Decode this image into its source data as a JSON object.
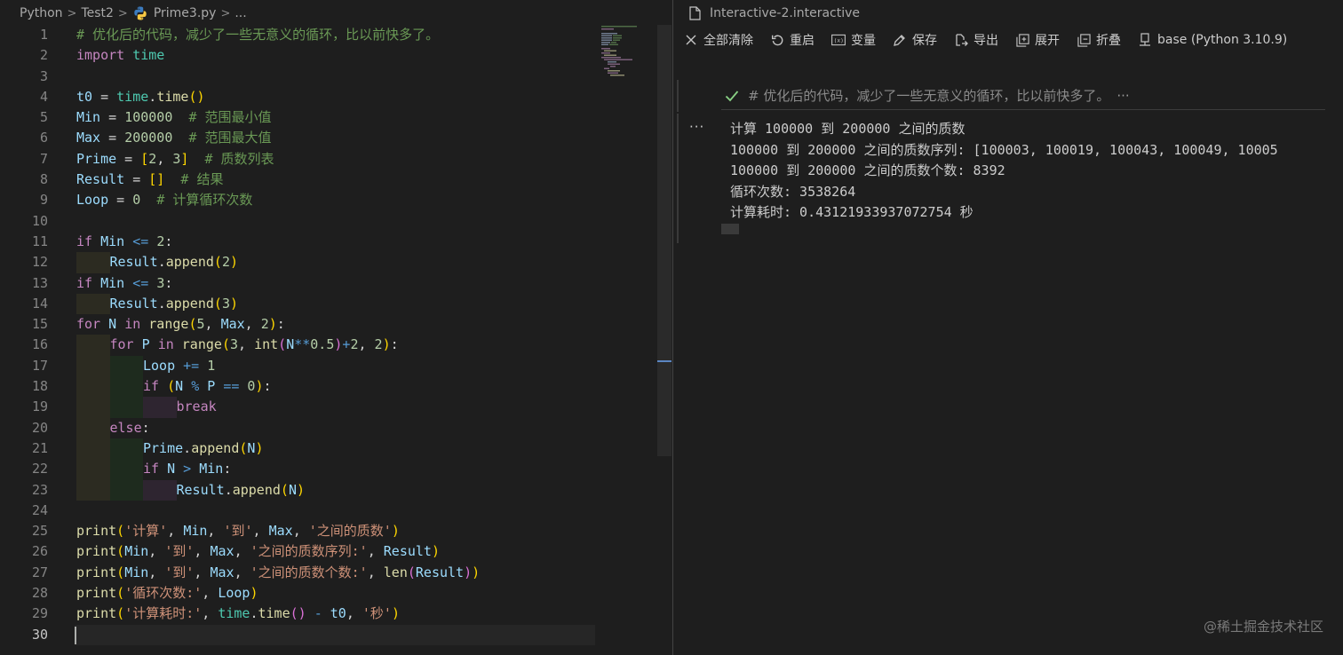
{
  "breadcrumb": {
    "items": [
      "Python",
      "Test2",
      "Prime3.py",
      "..."
    ],
    "separator": ">"
  },
  "editor": {
    "active_line": 30,
    "line_numbers": [
      "1",
      "2",
      "3",
      "4",
      "5",
      "6",
      "7",
      "8",
      "9",
      "10",
      "11",
      "12",
      "13",
      "14",
      "15",
      "16",
      "17",
      "18",
      "19",
      "20",
      "21",
      "22",
      "23",
      "24",
      "25",
      "26",
      "27",
      "28",
      "29",
      "30"
    ],
    "code": {
      "l1": "# 优化后的代码，减少了一些无意义的循环，比以前快多了。",
      "l2_kw": "import",
      "l2_mod": "time",
      "l4_var": "t0",
      "l4_mod": "time",
      "l4_fn": "time",
      "l5_var": "Min",
      "l5_num": "100000",
      "l5_cm": "# 范围最小值",
      "l6_var": "Max",
      "l6_num": "200000",
      "l6_cm": "# 范围最大值",
      "l7_var": "Prime",
      "l7_n1": "2",
      "l7_n2": "3",
      "l7_cm": "# 质数列表",
      "l8_var": "Result",
      "l8_cm": "# 结果",
      "l9_var": "Loop",
      "l9_num": "0",
      "l9_cm": "# 计算循环次数",
      "l11_kw": "if",
      "l11_var": "Min",
      "l11_num": "2",
      "l12_var": "Result",
      "l12_fn": "append",
      "l12_num": "2",
      "l13_kw": "if",
      "l13_var": "Min",
      "l13_num": "3",
      "l14_var": "Result",
      "l14_fn": "append",
      "l14_num": "3",
      "l15_kw": "for",
      "l15_var": "N",
      "l15_kw2": "in",
      "l15_fn": "range",
      "l15_n1": "5",
      "l15_var2": "Max",
      "l15_n2": "2",
      "l16_kw": "for",
      "l16_var": "P",
      "l16_kw2": "in",
      "l16_fn": "range",
      "l16_n1": "3",
      "l16_fn2": "int",
      "l16_var2": "N",
      "l16_n2": "0.5",
      "l16_n3": "2",
      "l16_n4": "2",
      "l17_var": "Loop",
      "l17_num": "1",
      "l18_kw": "if",
      "l18_var": "N",
      "l18_var2": "P",
      "l18_num": "0",
      "l19_kw": "break",
      "l20_kw": "else",
      "l21_var": "Prime",
      "l21_fn": "append",
      "l21_var2": "N",
      "l22_kw": "if",
      "l22_var": "N",
      "l22_var2": "Min",
      "l23_var": "Result",
      "l23_fn": "append",
      "l23_var2": "N",
      "l25_fn": "print",
      "l25_s1": "'计算'",
      "l25_v1": "Min",
      "l25_s2": "'到'",
      "l25_v2": "Max",
      "l25_s3": "'之间的质数'",
      "l26_fn": "print",
      "l26_v1": "Min",
      "l26_s1": "'到'",
      "l26_v2": "Max",
      "l26_s2": "'之间的质数序列:'",
      "l26_v3": "Result",
      "l27_fn": "print",
      "l27_v1": "Min",
      "l27_s1": "'到'",
      "l27_v2": "Max",
      "l27_s2": "'之间的质数个数:'",
      "l27_fn2": "len",
      "l27_v3": "Result",
      "l28_fn": "print",
      "l28_s1": "'循环次数:'",
      "l28_v1": "Loop",
      "l29_fn": "print",
      "l29_s1": "'计算耗时:'",
      "l29_mod": "time",
      "l29_fn2": "time",
      "l29_v1": "t0",
      "l29_s2": "'秒'"
    }
  },
  "panel": {
    "tab_title": "Interactive-2.interactive",
    "toolbar": {
      "clear_all": "全部清除",
      "restart": "重启",
      "variables": "变量",
      "save": "保存",
      "export": "导出",
      "expand": "展开",
      "collapse": "折叠",
      "kernel": "base (Python 3.10.9)"
    },
    "input_cell": {
      "text": "# 优化后的代码，减少了一些无意义的循环，比以前快多了。",
      "ellipsis": "···"
    },
    "output_ellipsis": "···",
    "output_lines": [
      "计算 100000 到 200000 之间的质数",
      "100000 到 200000 之间的质数序列: [100003, 100019, 100043, 100049, 10005",
      "100000 到 200000 之间的质数个数: 8392",
      "循环次数: 3538264",
      "计算耗时: 0.43121933937072754 秒"
    ]
  },
  "watermark": "@稀土掘金技术社区",
  "colors": {
    "background": "#1e1e1e",
    "keyword": "#c586c0",
    "builtin": "#569cd6",
    "function": "#dcdcaa",
    "variable": "#9cdcfe",
    "module": "#4ec9b0",
    "number": "#b5cea8",
    "comment": "#6a9955",
    "string": "#ce9178",
    "success_check": "#89d185"
  }
}
